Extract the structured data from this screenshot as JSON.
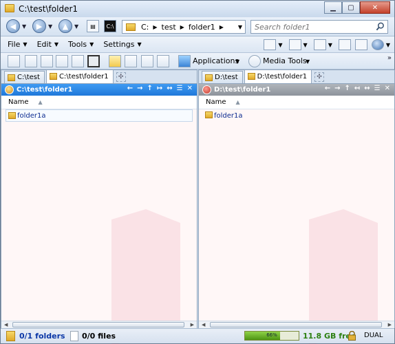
{
  "window": {
    "title": "C:\\test\\folder1",
    "minimize": "▁",
    "maximize": "▢",
    "close": "✕"
  },
  "nav": {
    "back_icon": "back-arrow-icon",
    "forward_icon": "forward-arrow-icon",
    "up_icon": "up-arrow-icon",
    "cmd_label": "C:\\",
    "address_crumbs": [
      "C:",
      "test",
      "folder1"
    ],
    "search_placeholder": "Search folder1"
  },
  "menu": {
    "items": [
      "File",
      "Edit",
      "Tools",
      "Settings"
    ]
  },
  "toolbar": {
    "applications_label": "Applications",
    "media_tools_label": "Media Tools"
  },
  "left_pane": {
    "tabs": [
      "C:\\test",
      "C:\\test\\folder1"
    ],
    "active_tab": 1,
    "path": "C:\\test\\folder1",
    "column_name": "Name",
    "items": [
      "folder1a"
    ]
  },
  "right_pane": {
    "tabs": [
      "D:\\test",
      "D:\\test\\folder1"
    ],
    "active_tab": 1,
    "path": "D:\\test\\folder1",
    "column_name": "Name",
    "items": [
      "folder1a"
    ]
  },
  "status": {
    "folders": "0/1 folders",
    "files": "0/0 files",
    "disk_percent": 66,
    "disk_percent_label": "66%",
    "free_space": "11.8 GB free",
    "mode": "DUAL"
  },
  "colors": {
    "active_path_bar": "#1f78d9",
    "inactive_path_bar": "#8d939b",
    "list_background": "#fff7f7",
    "folder_text": "#0a2a8f",
    "disk_bar": "#4d9413"
  }
}
